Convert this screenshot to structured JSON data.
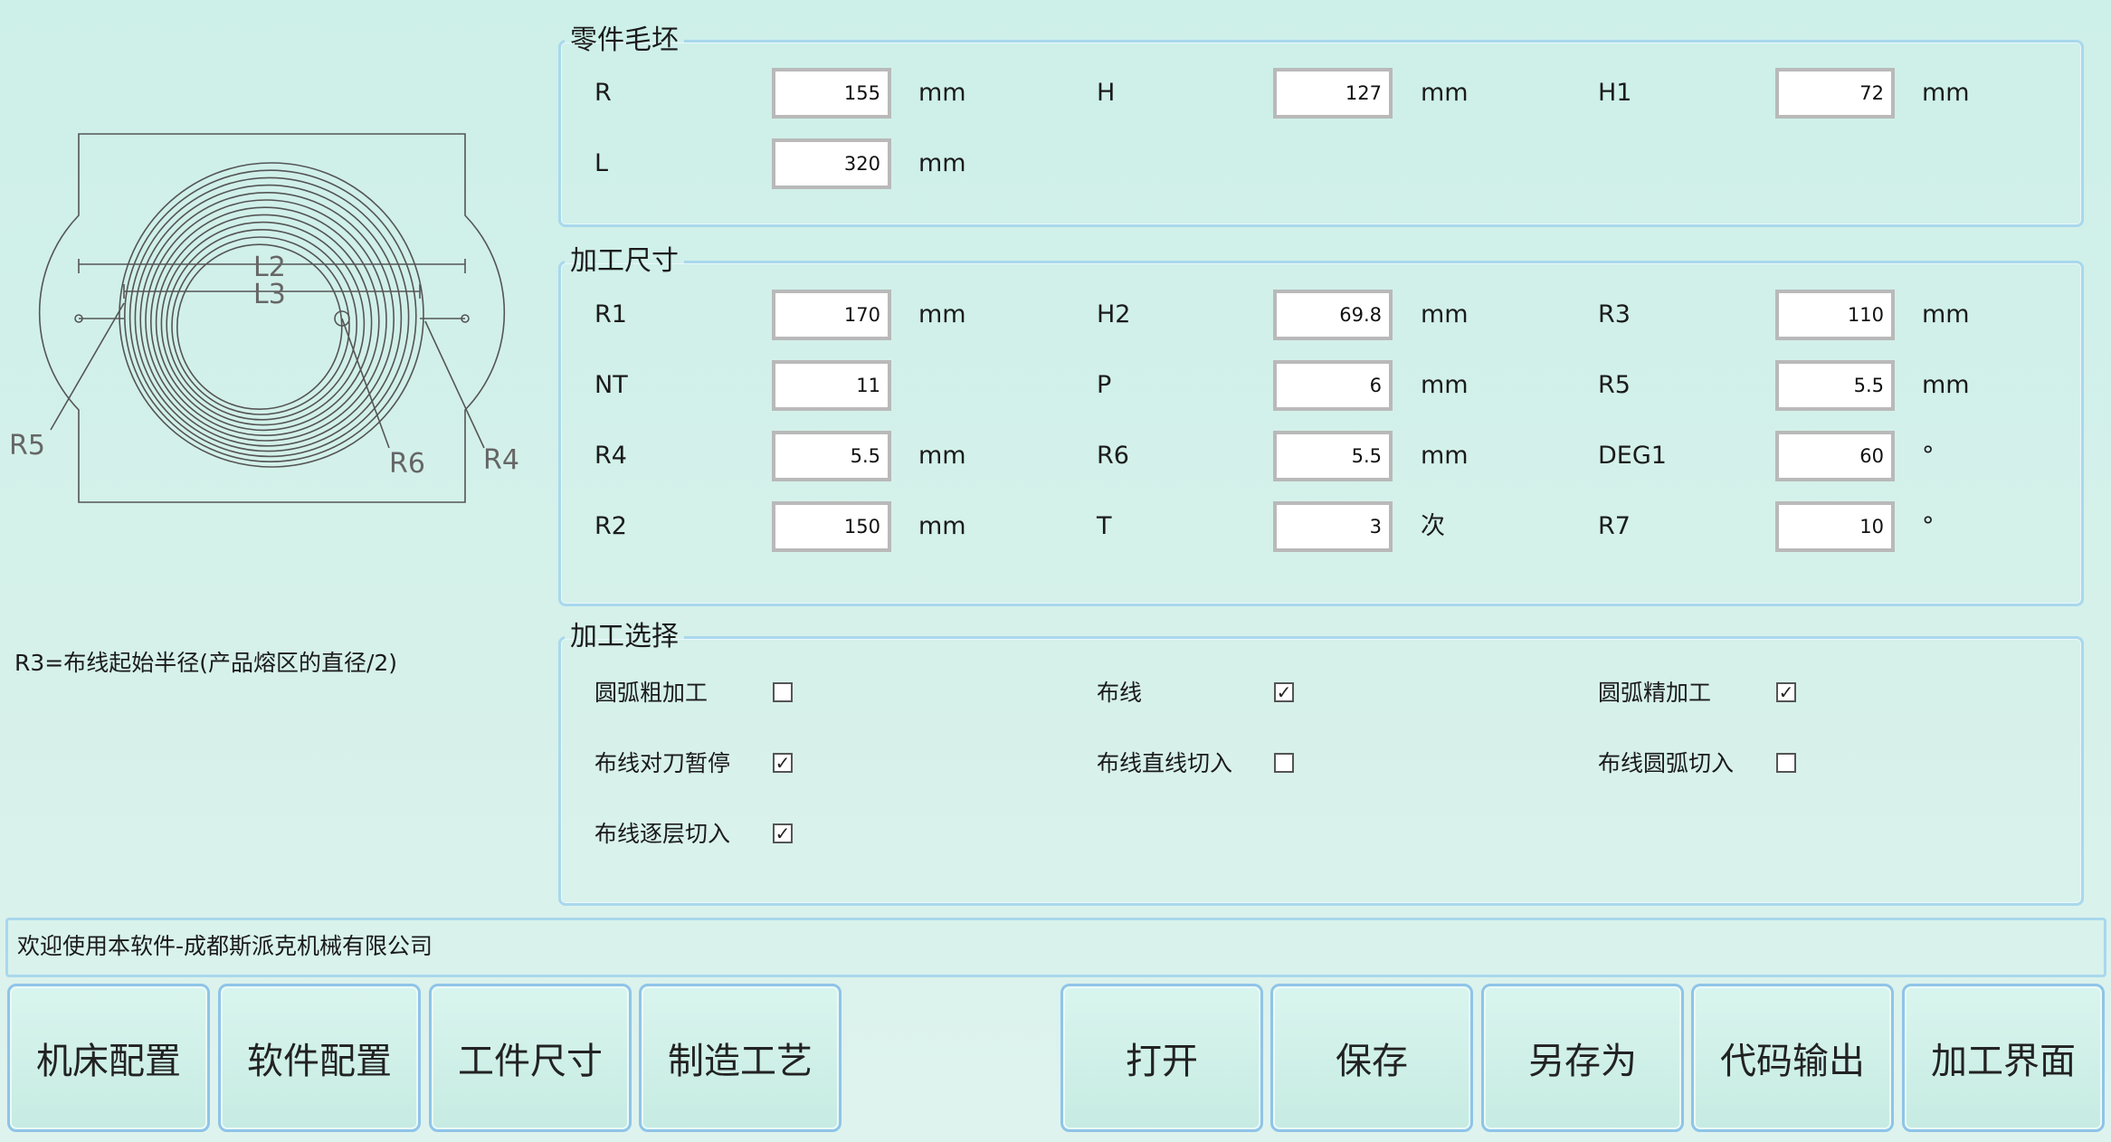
{
  "diagram": {
    "labels": {
      "l2": "L2",
      "l3": "L3",
      "r5": "R5",
      "r6": "R6",
      "r4": "R4"
    }
  },
  "note": "R3=布线起始半径(产品熔区的直径/2)",
  "blank": {
    "title": "零件毛坯",
    "fields": [
      {
        "label": "R",
        "value": "155",
        "unit": "mm"
      },
      {
        "label": "H",
        "value": "127",
        "unit": "mm"
      },
      {
        "label": "H1",
        "value": "72",
        "unit": "mm"
      },
      {
        "label": "L",
        "value": "320",
        "unit": "mm"
      }
    ]
  },
  "dims": {
    "title": "加工尺寸",
    "fields": [
      {
        "label": "R1",
        "value": "170",
        "unit": "mm"
      },
      {
        "label": "H2",
        "value": "69.8",
        "unit": "mm"
      },
      {
        "label": "R3",
        "value": "110",
        "unit": "mm"
      },
      {
        "label": "NT",
        "value": "11",
        "unit": ""
      },
      {
        "label": "P",
        "value": "6",
        "unit": "mm"
      },
      {
        "label": "R5",
        "value": "5.5",
        "unit": "mm"
      },
      {
        "label": "R4",
        "value": "5.5",
        "unit": "mm"
      },
      {
        "label": "R6",
        "value": "5.5",
        "unit": "mm"
      },
      {
        "label": "DEG1",
        "value": "60",
        "unit": "°"
      },
      {
        "label": "R2",
        "value": "150",
        "unit": "mm"
      },
      {
        "label": "T",
        "value": "3",
        "unit": "次"
      },
      {
        "label": "R7",
        "value": "10",
        "unit": "°"
      }
    ]
  },
  "options": {
    "title": "加工选择",
    "items": [
      {
        "label": "圆弧粗加工",
        "checked": false,
        "mark": ""
      },
      {
        "label": "布线",
        "checked": true,
        "mark": "✓"
      },
      {
        "label": "圆弧精加工",
        "checked": true,
        "mark": "✓"
      },
      {
        "label": "布线对刀暂停",
        "checked": true,
        "mark": "✓"
      },
      {
        "label": "布线直线切入",
        "checked": false,
        "mark": ""
      },
      {
        "label": "布线圆弧切入",
        "checked": false,
        "mark": ""
      },
      {
        "label": "布线逐层切入",
        "checked": true,
        "mark": "✓"
      }
    ]
  },
  "status": "欢迎使用本软件-成都斯派克机械有限公司",
  "buttons": {
    "machine_config": "机床配置",
    "software_config": "软件配置",
    "workpiece_size": "工件尺寸",
    "process": "制造工艺",
    "open": "打开",
    "save": "保存",
    "save_as": "另存为",
    "code_output": "代码输出",
    "machining_ui": "加工界面"
  },
  "colors": {
    "background": "#cdf0e9",
    "border": "#a9d8ec",
    "button_border": "#8fc4e8"
  }
}
